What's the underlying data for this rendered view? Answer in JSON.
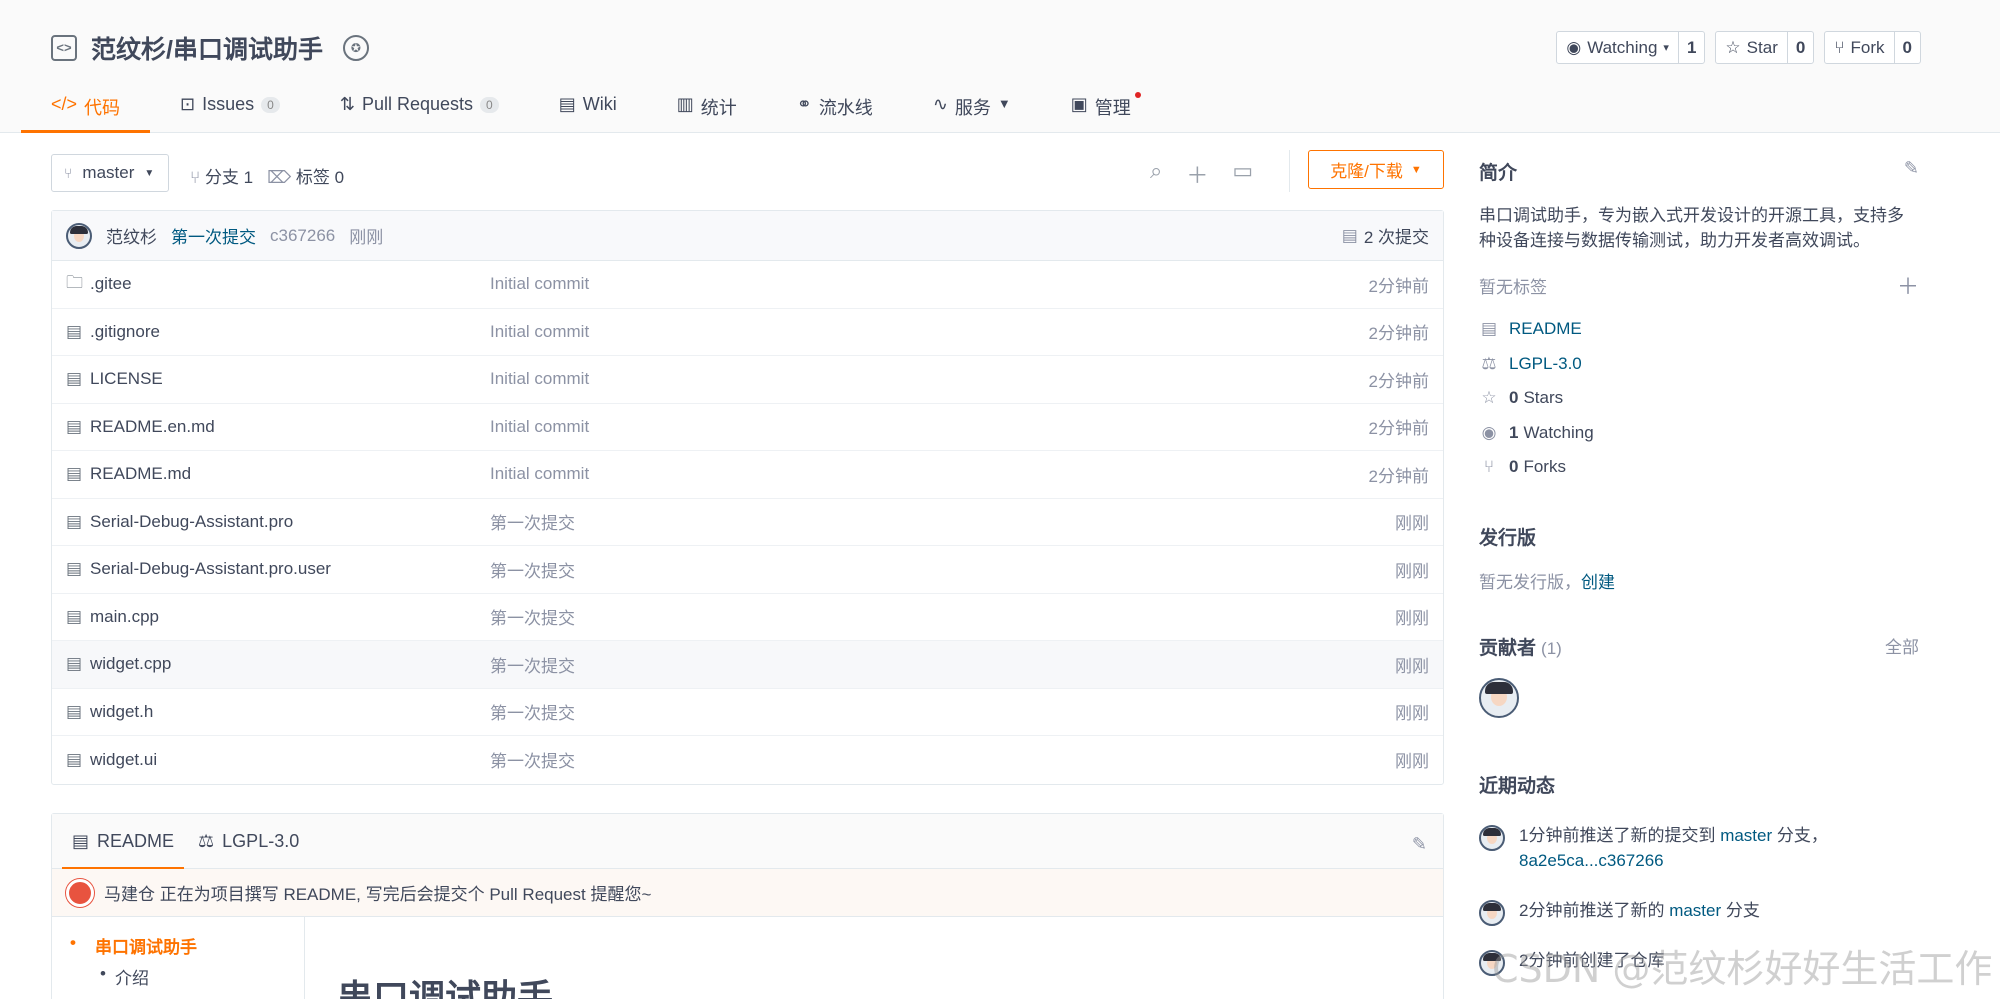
{
  "repo": {
    "full_name": "范纹杉/串口调试助手"
  },
  "actions": {
    "watch_label": "Watching",
    "watch_count": "1",
    "star_label": "Star",
    "star_count": "0",
    "fork_label": "Fork",
    "fork_count": "0"
  },
  "tabs": [
    {
      "label": "代码",
      "icon": "code-icon"
    },
    {
      "label": "Issues",
      "badge": "0",
      "icon": "issue-icon"
    },
    {
      "label": "Pull Requests",
      "badge": "0",
      "icon": "pull-request-icon"
    },
    {
      "label": "Wiki",
      "icon": "book-icon"
    },
    {
      "label": "统计",
      "icon": "bar-chart-icon"
    },
    {
      "label": "流水线",
      "icon": "pipeline-icon"
    },
    {
      "label": "服务",
      "icon": "pulse-icon"
    },
    {
      "label": "管理",
      "icon": "settings-doc-icon"
    }
  ],
  "toolbar": {
    "branch": "master",
    "branches": "分支 1",
    "tags": "标签 0",
    "clone_label": "克隆/下载"
  },
  "latest_commit": {
    "author": "范纹杉",
    "message": "第一次提交",
    "hash": "c367266",
    "time": "刚刚",
    "count": "2 次提交"
  },
  "files": [
    {
      "name": ".gitee",
      "type": "folder",
      "commit": "Initial commit",
      "time": "2分钟前"
    },
    {
      "name": ".gitignore",
      "type": "file",
      "commit": "Initial commit",
      "time": "2分钟前"
    },
    {
      "name": "LICENSE",
      "type": "file",
      "commit": "Initial commit",
      "time": "2分钟前"
    },
    {
      "name": "README.en.md",
      "type": "file",
      "commit": "Initial commit",
      "time": "2分钟前"
    },
    {
      "name": "README.md",
      "type": "file",
      "commit": "Initial commit",
      "time": "2分钟前"
    },
    {
      "name": "Serial-Debug-Assistant.pro",
      "type": "file",
      "commit": "第一次提交",
      "time": "刚刚"
    },
    {
      "name": "Serial-Debug-Assistant.pro.user",
      "type": "file",
      "commit": "第一次提交",
      "time": "刚刚"
    },
    {
      "name": "main.cpp",
      "type": "file",
      "commit": "第一次提交",
      "time": "刚刚"
    },
    {
      "name": "widget.cpp",
      "type": "file",
      "commit": "第一次提交",
      "time": "刚刚"
    },
    {
      "name": "widget.h",
      "type": "file",
      "commit": "第一次提交",
      "time": "刚刚"
    },
    {
      "name": "widget.ui",
      "type": "file",
      "commit": "第一次提交",
      "time": "刚刚"
    }
  ],
  "readme": {
    "tab_readme": "README",
    "tab_license": "LGPL-3.0",
    "notice": "马建仓 正在为项目撰写 README, 写完后会提交个 Pull Request 提醒您~",
    "toc": [
      "串口调试助手",
      "介绍"
    ],
    "heading": "串口调试助手"
  },
  "sidebar": {
    "intro_title": "简介",
    "description": "串口调试助手，专为嵌入式开发设计的开源工具，支持多种设备连接与数据传输测试，助力开发者高效调试。",
    "no_tags": "暂无标签",
    "meta": {
      "readme": "README",
      "license": "LGPL-3.0",
      "stars_num": "0",
      "stars_label": "Stars",
      "watching_num": "1",
      "watching_label": "Watching",
      "forks_num": "0",
      "forks_label": "Forks"
    },
    "releases_title": "发行版",
    "no_releases": "暂无发行版，",
    "create_link": "创建",
    "contributors_title": "贡献者",
    "contributors_count": "(1)",
    "contributors_all": "全部",
    "activity_title": "近期动态",
    "activity": [
      {
        "prefix": "1分钟前推送了新的提交到 ",
        "branch": "master",
        "mid": " 分支，",
        "link": "8a2e5ca...c367266"
      },
      {
        "prefix": "2分钟前推送了新的 ",
        "branch": "master",
        "mid": " 分支",
        "link": ""
      },
      {
        "prefix": "2分钟前创建了仓库",
        "branch": "",
        "mid": "",
        "link": ""
      }
    ]
  },
  "watermark": "CSDN @范纹杉好好生活工作"
}
